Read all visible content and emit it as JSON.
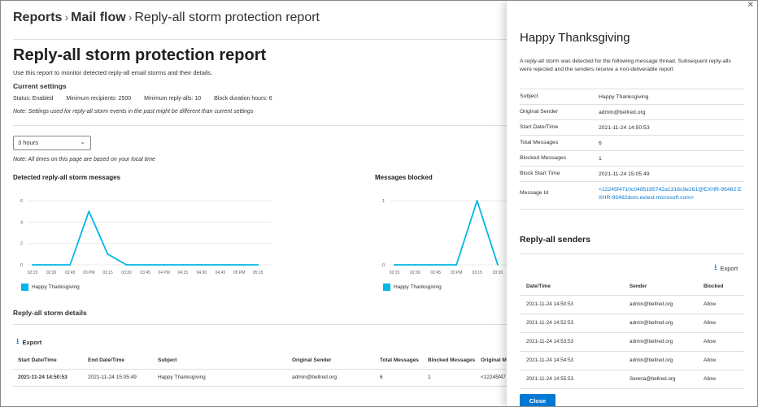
{
  "breadcrumb": {
    "items": [
      "Reports",
      "Mail flow",
      "Reply-all storm protection report"
    ]
  },
  "page": {
    "title": "Reply-all storm protection report",
    "description": "Use this report to monitor detected reply-all email storms and their details."
  },
  "settings": {
    "heading": "Current settings",
    "status": "Status:  Enabled",
    "min_recipients": "Minimum recipients:  2500",
    "min_replyalls": "Minimum reply-alls:  10",
    "block_duration": "Block duration hours:  6",
    "note": "Note: Settings used for reply-all storm events in the past might be different than current settings"
  },
  "time_range": {
    "selected": "3 hours",
    "icon": "chevron-down-icon",
    "note": "Note: All times on this page are based on your local time"
  },
  "colors": {
    "series": "#00b7e6",
    "accent": "#0078d4"
  },
  "chart_data": [
    {
      "type": "line",
      "title": "Detected reply-all storm messages",
      "x": [
        "02:15",
        "02:30",
        "02:45",
        "03 PM",
        "03:15",
        "03:30",
        "03:45",
        "04 PM",
        "04:15",
        "04:30",
        "04:45",
        "05 PM",
        "05:15"
      ],
      "series": [
        {
          "name": "Happy Thanksgiving",
          "values": [
            0,
            0,
            0,
            5,
            1,
            0,
            0,
            0,
            0,
            0,
            0,
            0,
            0
          ]
        }
      ],
      "yticks": [
        0,
        2,
        4,
        6
      ],
      "ylim": [
        0,
        6
      ],
      "grid": true,
      "legend": "bottom-left"
    },
    {
      "type": "line",
      "title": "Messages blocked",
      "x": [
        "02:15",
        "02:30",
        "02:45",
        "03 PM",
        "03:15",
        "03:30"
      ],
      "series": [
        {
          "name": "Happy Thanksgiving",
          "values": [
            0,
            0,
            0,
            0,
            1,
            0
          ]
        }
      ],
      "yticks": [
        0,
        1
      ],
      "ylim": [
        0,
        1
      ],
      "grid": true,
      "legend": "bottom-left"
    }
  ],
  "details": {
    "title": "Reply-all storm details",
    "export_label": "Export",
    "columns": [
      "Start Date/Time",
      "End Date/Time",
      "Subject",
      "Original Sender",
      "Total Messages",
      "Blocked Messages",
      "Original M"
    ],
    "rows": [
      [
        "2021-11-24 14:50:53",
        "2021-11-24 15:05:49",
        "Happy Thanksgiving",
        "admin@bellred.org",
        "6",
        "1",
        "<12245f47"
      ]
    ]
  },
  "panel": {
    "title": "Happy Thanksgiving",
    "description": "A reply-all storm was detected for the following message thread. Subsequent reply-alls were rejected and the senders receive a non-deliverable report",
    "fields": [
      {
        "label": "Subject",
        "value": "Happy Thanksgiving"
      },
      {
        "label": "Original Sender",
        "value": "admin@bellred.org"
      },
      {
        "label": "Start Date/Time",
        "value": "2021-11-24 14:50:53"
      },
      {
        "label": "Total Messages",
        "value": "6"
      },
      {
        "label": "Blocked Messages",
        "value": "1"
      },
      {
        "label": "Block Start Time",
        "value": "2021-11-24 15:05:49"
      },
      {
        "label": "Message Id",
        "value": "<12245f4710c0485195742a1316c9e261@EXHR-95482.EXHR-95482dom.extest.microsoft.com>"
      }
    ],
    "senders_title": "Reply-all senders",
    "export_label": "Export",
    "sender_columns": [
      "Date/Time",
      "Sender",
      "Blocked"
    ],
    "senders": [
      [
        "2021-11-24 14:50:53",
        "admin@bellred.org",
        "Allow"
      ],
      [
        "2021-11-24 14:52:53",
        "admin@bellred.org",
        "Allow"
      ],
      [
        "2021-11-24 14:53:53",
        "admin@bellred.org",
        "Allow"
      ],
      [
        "2021-11-24 14:54:53",
        "admin@bellred.org",
        "Allow"
      ],
      [
        "2021-11-24 14:55:53",
        "Serena@bellred.org",
        "Allow"
      ]
    ],
    "close_label": "Close"
  }
}
